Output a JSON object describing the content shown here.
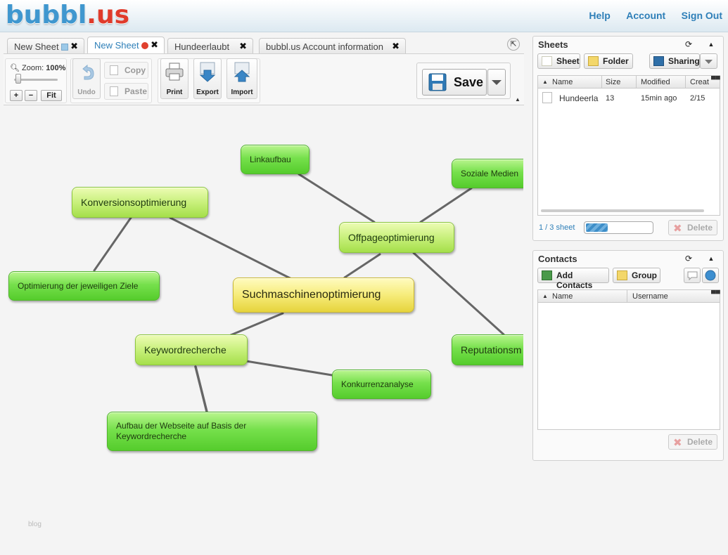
{
  "header": {
    "logo_part1": "bubbl",
    "logo_part2": ".us",
    "nav": [
      "Help",
      "Account",
      "Sign Out"
    ]
  },
  "tabs": [
    {
      "label": "New Sheet",
      "marker": "square"
    },
    {
      "label": "New Sheet",
      "marker": "dot",
      "active": true
    },
    {
      "label": "Hundeerlaubt",
      "marker": ""
    },
    {
      "label": "bubbl.us Account information",
      "marker": ""
    }
  ],
  "toolbar": {
    "zoom_label": "Zoom:",
    "zoom_value": "100%",
    "zoom_in": "+",
    "zoom_out": "−",
    "fit": "Fit",
    "undo": "Undo",
    "copy": "Copy",
    "paste": "Paste",
    "print": "Print",
    "export": "Export",
    "import": "Import",
    "save": "Save"
  },
  "mindmap": {
    "nodes": {
      "center": "Suchmaschinenoptimierung",
      "konversion": "Konversionsoptimierung",
      "ziele": "Optimierung der jeweiligen Ziele",
      "linkaufbau": "Linkaufbau",
      "offpage": "Offpageoptimierung",
      "soziale": "Soziale Medien",
      "reputation": "Reputationsm",
      "keyword": "Keywordrecherche",
      "konkurrenz": "Konkurrenzanalyse",
      "aufbau_line1": "Aufbau der Webseite auf Basis der",
      "aufbau_line2": "Keywordrecherche"
    },
    "watermark": "blog"
  },
  "sheets_panel": {
    "title": "Sheets",
    "buttons": {
      "sheet": "Sheet",
      "folder": "Folder",
      "sharing": "Sharing"
    },
    "columns": [
      "Name",
      "Size",
      "Modified",
      "Creat"
    ],
    "rows": [
      {
        "name": "Hundeerla",
        "size": "13",
        "modified": "15min ago",
        "created": "2/15"
      }
    ],
    "count": "1 / 3 sheet",
    "quota_fraction": 0.33,
    "delete": "Delete"
  },
  "contacts_panel": {
    "title": "Contacts",
    "buttons": {
      "add": "Add Contacts",
      "group": "Group"
    },
    "columns": [
      "Name",
      "Username"
    ],
    "delete": "Delete"
  },
  "colors": {
    "link": "#2e7fb8",
    "logo_blue": "#3f97cf",
    "logo_red": "#e03b2b",
    "node_green": "#76e04c",
    "node_lime": "#c8f07c",
    "node_yellow": "#f6ec7a",
    "connector": "#666666"
  }
}
